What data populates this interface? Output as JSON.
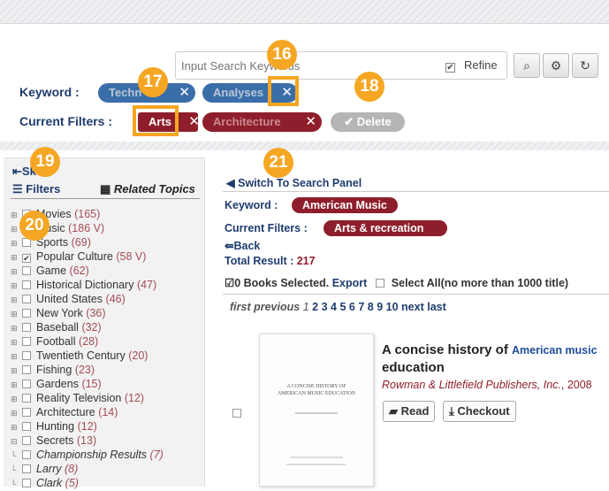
{
  "search": {
    "placeholder": "Input Search Keywords",
    "refine_label": "Refine"
  },
  "toolbar": {
    "search_icon": "magnifier-icon",
    "settings_icon": "gear-icon",
    "refresh_icon": "refresh-icon"
  },
  "keyword_label": "Keyword :",
  "keywords": [
    "Techn",
    "Analyses"
  ],
  "filters_label": "Current Filters :",
  "filters": [
    "Arts",
    "Architecture"
  ],
  "delete_label": "Delete",
  "callouts": [
    "16",
    "17",
    "18",
    "19",
    "20",
    "21"
  ],
  "left": {
    "skip_label": "Sk",
    "filters_tab": "Filters",
    "related_tab": "Related Topics",
    "items": [
      {
        "label": "Movies",
        "count": "(165)"
      },
      {
        "label": "Music",
        "count": "(186 V)"
      },
      {
        "label": "Sports",
        "count": "(69)"
      },
      {
        "label": "Popular Culture",
        "count": "(58 V)"
      },
      {
        "label": "Game",
        "count": "(62)"
      },
      {
        "label": "Historical Dictionary",
        "count": "(47)"
      },
      {
        "label": "United States",
        "count": "(46)"
      },
      {
        "label": "New York",
        "count": "(36)"
      },
      {
        "label": "Baseball",
        "count": "(32)"
      },
      {
        "label": "Football",
        "count": "(28)"
      },
      {
        "label": "Twentieth Century",
        "count": "(20)"
      },
      {
        "label": "Fishing",
        "count": "(23)"
      },
      {
        "label": "Gardens",
        "count": "(15)"
      },
      {
        "label": "Reality Television",
        "count": "(12)"
      },
      {
        "label": "Architecture",
        "count": "(14)"
      },
      {
        "label": "Hunting",
        "count": "(12)"
      },
      {
        "label": "Secrets",
        "count": "(13)"
      },
      {
        "label": "Championship Results",
        "count": "(7)"
      },
      {
        "label": "Larry",
        "count": "(8)"
      },
      {
        "label": "Clark",
        "count": "(5)"
      }
    ]
  },
  "right": {
    "switch_label": "Switch To Search Panel",
    "keyword_label": "Keyword :",
    "keyword_value": "American Music",
    "filters_label": "Current Filters :",
    "filter_value": "Arts & recreation",
    "back_label": "Back",
    "total_label": "Total Result :",
    "total_value": "217",
    "books_selected": "0 Books Selected.",
    "export_label": "Export",
    "select_all_label": "Select All(no more than 1000 title)",
    "pagination": {
      "first": "first",
      "previous": "previous",
      "current": "1",
      "pages": [
        "2",
        "3",
        "4",
        "5",
        "6",
        "7",
        "8",
        "9",
        "10"
      ],
      "next": "next",
      "last": "last"
    },
    "book": {
      "title_prefix": "A concise history of",
      "title_highlight": "American music",
      "title_suffix": "education",
      "publisher": "Rowman & Littlefield Publishers, Inc.",
      "year": ", 2008",
      "cover_title": "A CONCISE HISTORY OF AMERICAN MUSIC EDUCATION",
      "read_label": "Read",
      "checkout_label": "Checkout"
    }
  },
  "colors": {
    "accent_orange": "#f5a623",
    "keyword_blue": "#3a6ea9",
    "filter_red": "#8e1e2b",
    "label_navy": "#1f3c6e"
  }
}
